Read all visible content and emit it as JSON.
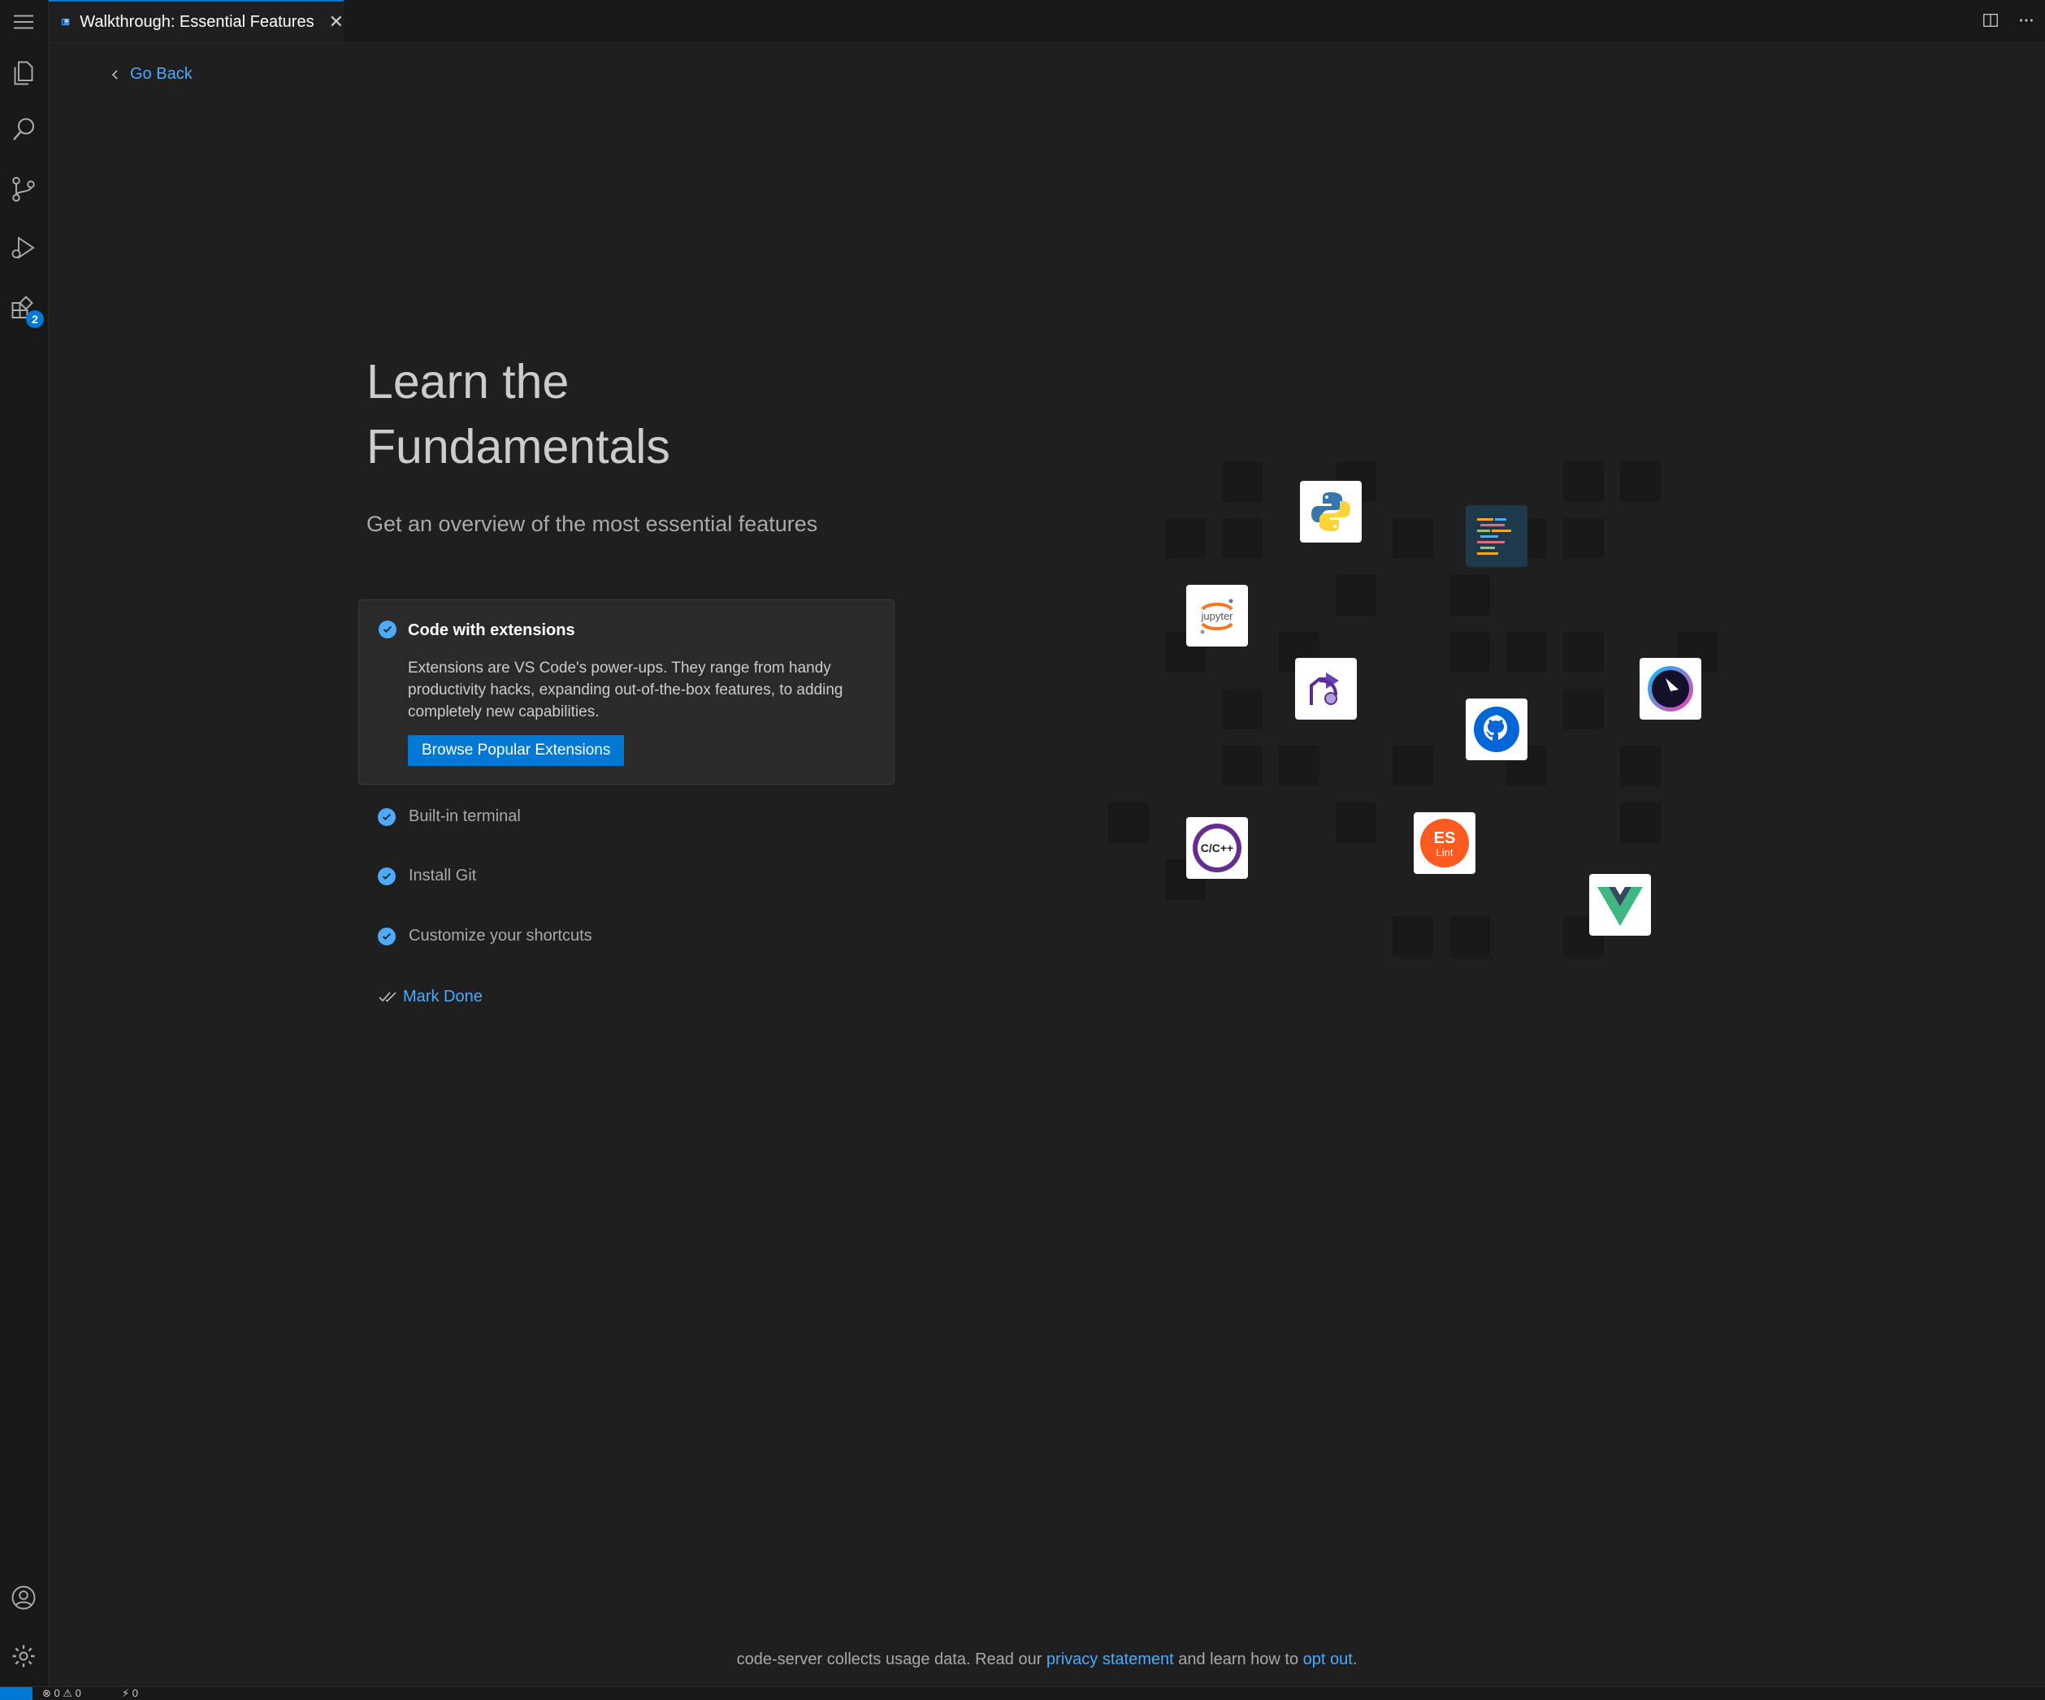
{
  "tab": {
    "title": "Walkthrough: Essential Features",
    "close_glyph": "✕"
  },
  "activity_bar": {
    "items": [
      "menu-icon",
      "explorer-icon",
      "search-icon",
      "source-control-icon",
      "run-debug-icon",
      "extensions-icon"
    ],
    "extensions_badge": "2",
    "bottom_items": [
      "account-icon",
      "settings-gear-icon"
    ]
  },
  "nav": {
    "go_back": "Go Back"
  },
  "walkthrough": {
    "title": "Learn the Fundamentals",
    "subtitle": "Get an overview of the most essential features",
    "active_step": {
      "title": "Code with extensions",
      "description": "Extensions are VS Code's power-ups. They range from handy productivity hacks, expanding out-of-the-box features, to adding completely new capabilities.",
      "button": "Browse Popular Extensions"
    },
    "steps": [
      "Built-in terminal",
      "Install Git",
      "Customize your shortcuts"
    ],
    "mark_done": "Mark Done"
  },
  "illustration": {
    "logos": [
      "python-logo-icon",
      "code-lines-icon",
      "jupyter-logo-icon",
      "live-share-icon",
      "github-logo-icon",
      "remote-icon",
      "cpp-logo-icon",
      "eslint-logo-icon",
      "vue-logo-icon"
    ],
    "jupyter_text": "jupyter",
    "cpp_text": "C/C++",
    "eslint_text": "ES",
    "eslint_sub": "Lint"
  },
  "footer": {
    "prefix": "code-server collects usage data. Read our",
    "privacy_link": "privacy statement",
    "middle": "and learn how to",
    "opt_out_link": "opt out",
    "suffix": "."
  },
  "status_bar": {
    "errors": "0",
    "warnings": "0",
    "ports": "0"
  },
  "colors": {
    "accent": "#0078d4",
    "link": "#4daafc",
    "background": "#1f1f1f",
    "sidebar": "#181818"
  }
}
